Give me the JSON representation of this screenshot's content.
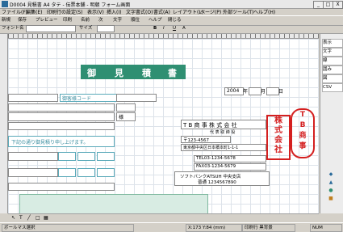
{
  "window": {
    "title": "D0004 見積書 A4 タテ - 伝票本舗 - 明朝 フォーム画面",
    "minimize": "_",
    "maximize": "□",
    "close": "X"
  },
  "menu": [
    "ファイル(F)",
    "編集(E)",
    "印刷行の設定(S)",
    "表示(V)",
    "挿入(I)",
    "文字書式(O)",
    "書式(A)",
    "レイアウト(L)",
    "ページ(P)",
    "外部ツール(T)",
    "ヘルプ(H)"
  ],
  "toolbar": {
    "buttons": [
      "新規",
      "保存",
      "プレビュー",
      "印刷",
      "名前",
      "次",
      "文字",
      "順位",
      "ヘルプ",
      "閉じる"
    ],
    "row2_left": "フォント名",
    "row2_size": "サイズ",
    "row2_format": [
      "B",
      "I",
      "U",
      "A"
    ]
  },
  "document": {
    "title_chars": [
      "御",
      "見",
      "積",
      "書"
    ],
    "customer_label": "御客様コード",
    "date": "2004",
    "year_label": "年",
    "month_label": "月",
    "day_label": "日",
    "suffix_sama": "様",
    "request_text": "下記の通り御見積り申し上げます。",
    "company_name": "T B 商 事 株 式 会 社",
    "company_sub": "代 表 取 締 役",
    "postal": "〒123-4567",
    "address": "東京都中央区日本橋本町1-1-1",
    "tel": "TEL03-1234-5678",
    "fax": "FAX03-1234-5679",
    "bank": "ソフトバンクATSUH 中央支店",
    "account": "普通 1234567890",
    "stamp_square": [
      "株",
      "式",
      "会",
      "社"
    ],
    "stamp_round": [
      "T",
      "B",
      "商",
      "事"
    ]
  },
  "right_panel": [
    "表示",
    "文字",
    "線",
    "囲み",
    "図",
    "CSV"
  ],
  "statusbar": {
    "left": "ボールマス選択",
    "coord": "X:173 Y:84 (mm)",
    "mode": "印刷行 黒背景",
    "insert": "NUM"
  }
}
